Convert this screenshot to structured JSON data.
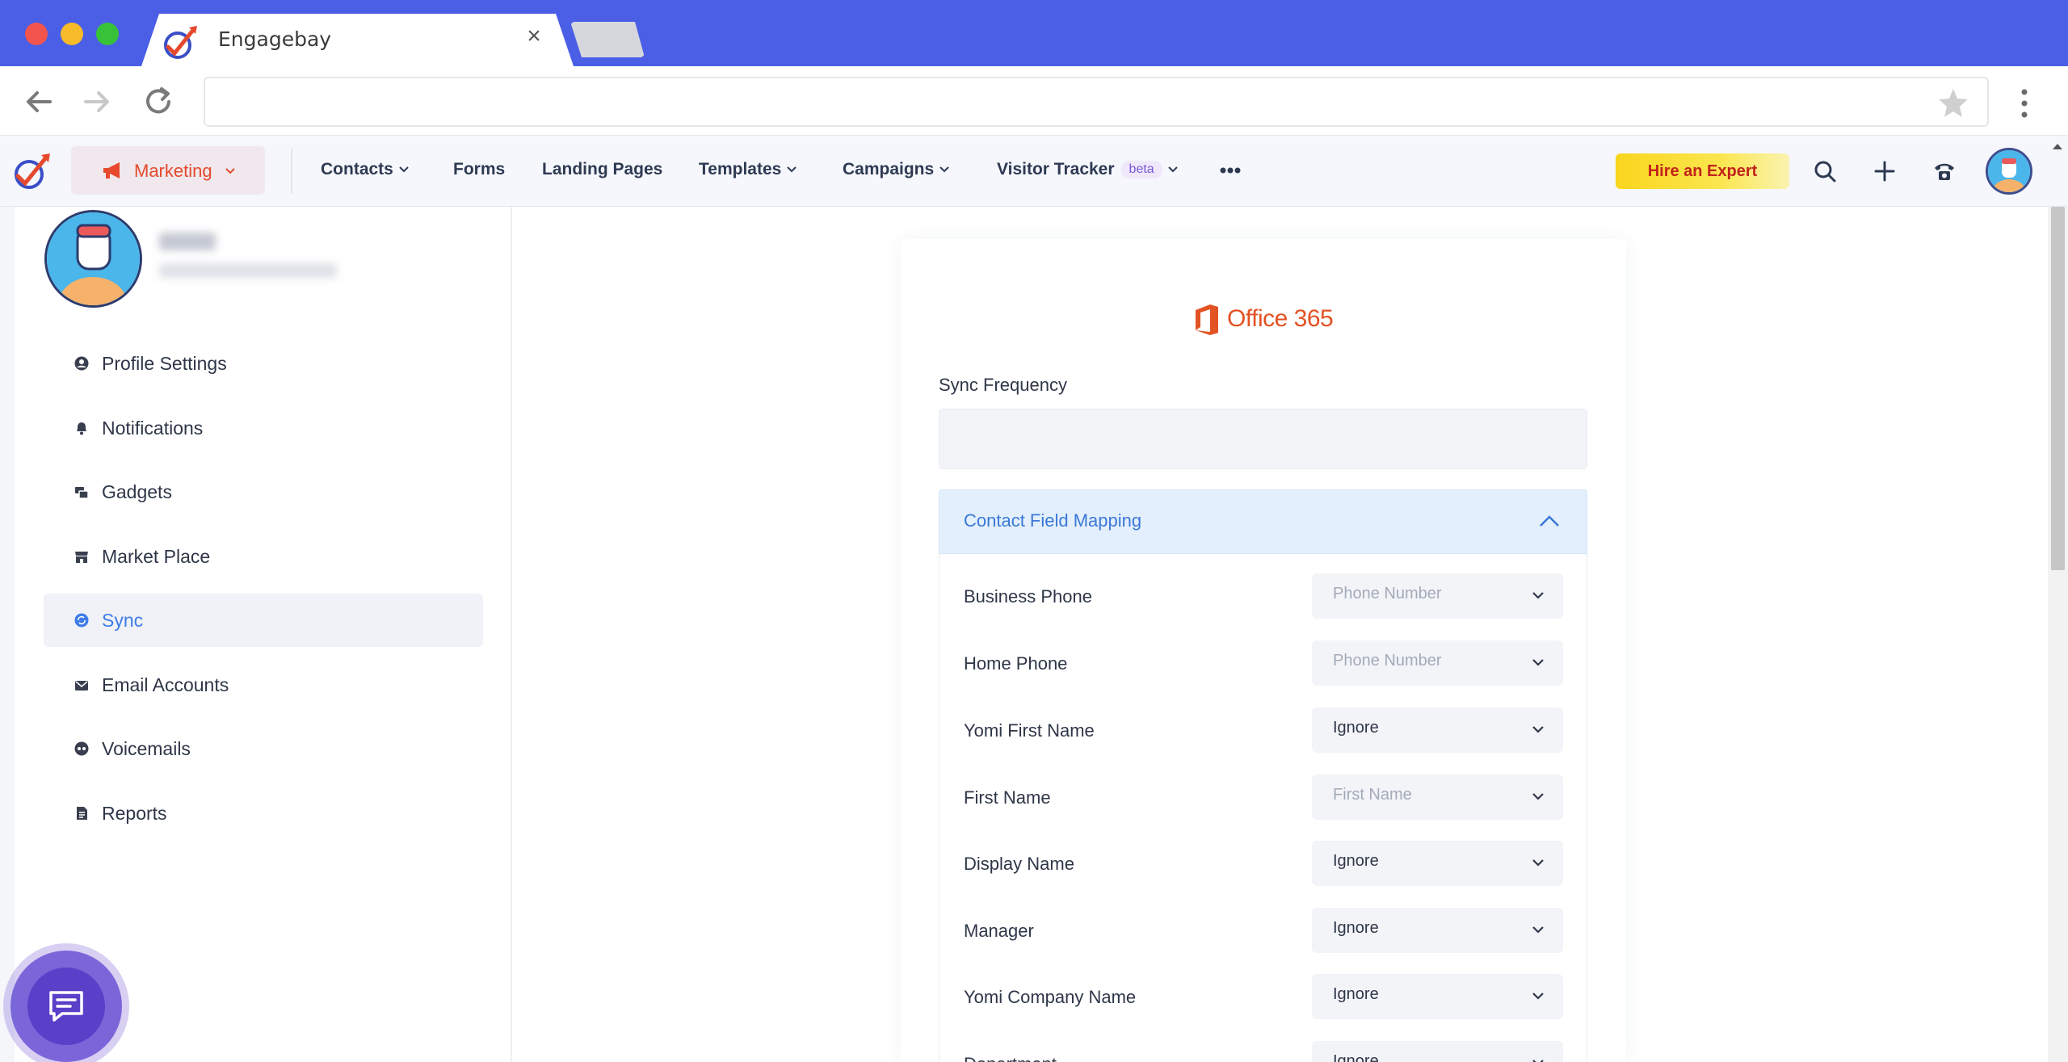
{
  "browser": {
    "tab_title": "Engagebay",
    "tab_close": "×",
    "url": ""
  },
  "header": {
    "module": "Marketing",
    "nav": [
      {
        "label": "Contacts",
        "has_dropdown": true
      },
      {
        "label": "Forms",
        "has_dropdown": false
      },
      {
        "label": "Landing Pages",
        "has_dropdown": false
      },
      {
        "label": "Templates",
        "has_dropdown": true
      },
      {
        "label": "Campaigns",
        "has_dropdown": true
      },
      {
        "label": "Visitor Tracker",
        "badge": "beta",
        "has_dropdown": true
      }
    ],
    "hire_button": "Hire an Expert",
    "icons": [
      "search-icon",
      "plus-icon",
      "phone-icon",
      "avatar"
    ]
  },
  "sidebar": {
    "items": [
      {
        "label": "Profile Settings",
        "icon": "user-circle-icon"
      },
      {
        "label": "Notifications",
        "icon": "bell-icon"
      },
      {
        "label": "Gadgets",
        "icon": "gadgets-icon"
      },
      {
        "label": "Market Place",
        "icon": "store-icon"
      },
      {
        "label": "Sync",
        "icon": "sync-icon",
        "active": true
      },
      {
        "label": "Email Accounts",
        "icon": "envelope-icon"
      },
      {
        "label": "Voicemails",
        "icon": "voicemail-icon"
      },
      {
        "label": "Reports",
        "icon": "report-icon"
      }
    ]
  },
  "main": {
    "provider": "Office 365",
    "sync_frequency_label": "Sync Frequency",
    "sync_frequency_value": "",
    "mapping_title": "Contact Field Mapping",
    "rows": [
      {
        "field": "Business Phone",
        "value": "Phone Number",
        "placeholder": true
      },
      {
        "field": "Home Phone",
        "value": "Phone Number",
        "placeholder": true
      },
      {
        "field": "Yomi First Name",
        "value": "Ignore",
        "placeholder": false
      },
      {
        "field": "First Name",
        "value": "First Name",
        "placeholder": true
      },
      {
        "field": "Display Name",
        "value": "Ignore",
        "placeholder": false
      },
      {
        "field": "Manager",
        "value": "Ignore",
        "placeholder": false
      },
      {
        "field": "Yomi Company Name",
        "value": "Ignore",
        "placeholder": false
      },
      {
        "field": "Department",
        "value": "Ignore",
        "placeholder": false
      }
    ]
  },
  "colors": {
    "browser_tabbar": "#4a5fe6",
    "accent_blue": "#3a78d8",
    "marketing_red": "#e6492d",
    "office_orange": "#e35222",
    "hire_yellow": "#f9d51d"
  }
}
